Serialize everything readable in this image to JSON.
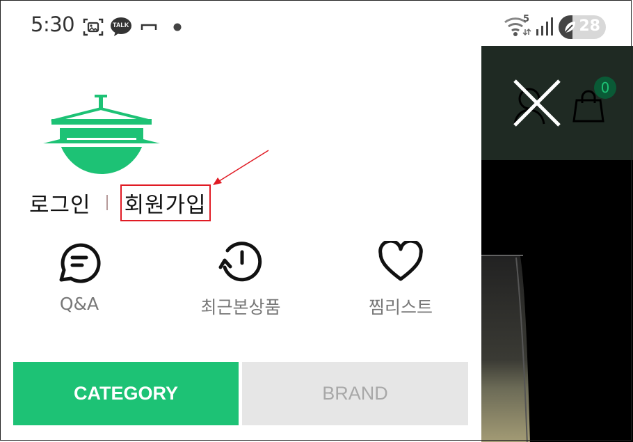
{
  "status_bar": {
    "time": "5:30",
    "icons": [
      "screenshot-icon",
      "kakaotalk-icon",
      "minus-icon",
      "dot-icon",
      "wifi-icon",
      "signal-icon"
    ],
    "battery": "28",
    "kakao_badge": "TALK",
    "wifi_label": "5"
  },
  "drawer": {
    "auth": {
      "login": "로그인",
      "signup": "회원가입"
    },
    "quick_links": [
      {
        "icon": "chat-icon",
        "label": "Q&A"
      },
      {
        "icon": "history-icon",
        "label": "최근본상품"
      },
      {
        "icon": "heart-icon",
        "label": "찜리스트"
      }
    ],
    "tabs": {
      "category": "CATEGORY",
      "brand": "BRAND"
    }
  },
  "background_page": {
    "cart_count": "0"
  },
  "colors": {
    "brand_green": "#1dc275",
    "header_dark": "#1f2a23",
    "annotation_red": "#e01b24"
  }
}
